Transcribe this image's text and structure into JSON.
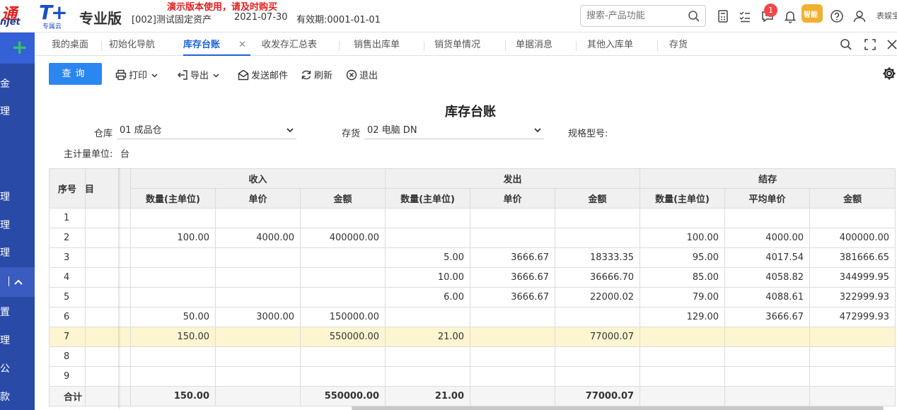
{
  "header": {
    "logo_cn": "通",
    "logo_en": "njet",
    "product_mark": "T+",
    "product_sub": "专属云",
    "edition": "专业版",
    "demo_notice": "演示版本使用，请及时购买",
    "account": "[002]测试固定资产",
    "date": "2021-07-30",
    "validity": "有效期:0001-01-01",
    "search_placeholder": "搜索-产品功能",
    "notification_count": "1",
    "mascot_text": "智能",
    "user_name": "表娱宝"
  },
  "sidebar": {
    "items": [
      "金",
      "理",
      "理",
      "理",
      "理",
      "置",
      "理",
      "公",
      "款"
    ]
  },
  "tabs": [
    {
      "label": "我的桌面"
    },
    {
      "label": "初始化导航"
    },
    {
      "label": "库存台账",
      "active": true
    },
    {
      "label": "收发存汇总表"
    },
    {
      "label": "销售出库单"
    },
    {
      "label": "销货单情况"
    },
    {
      "label": "单据消息"
    },
    {
      "label": "其他入库单"
    },
    {
      "label": "存货"
    }
  ],
  "tab_close": "✕",
  "toolbar": {
    "query": "查询",
    "print": "打印",
    "export": "导出",
    "send_mail": "发送邮件",
    "refresh": "刷新",
    "exit": "退出"
  },
  "report": {
    "title": "库存台账",
    "warehouse_label": "仓库",
    "warehouse_value": "01 成品仓",
    "inventory_label": "存货",
    "inventory_value": "02 电脑 DN",
    "spec_label": "规格型号:",
    "unit_label": "主计量单位:",
    "unit_value": "台"
  },
  "table": {
    "col_seq": "序号",
    "col_project": "项目",
    "groups": [
      "收入",
      "发出",
      "结存"
    ],
    "sub_headers": [
      "数量(主单位)",
      "单价",
      "金额",
      "数量(主单位)",
      "单价",
      "金额",
      "数量(主单位)",
      "平均单价",
      "金额"
    ],
    "rows": [
      [
        "1",
        "",
        "",
        "",
        "",
        "",
        "",
        "",
        "",
        "",
        ""
      ],
      [
        "2",
        "",
        "100.00",
        "4000.00",
        "400000.00",
        "",
        "",
        "",
        "100.00",
        "4000.00",
        "400000.00"
      ],
      [
        "3",
        "",
        "",
        "",
        "",
        "5.00",
        "3666.67",
        "18333.35",
        "95.00",
        "4017.54",
        "381666.65"
      ],
      [
        "4",
        "",
        "",
        "",
        "",
        "10.00",
        "3666.67",
        "36666.70",
        "85.00",
        "4058.82",
        "344999.95"
      ],
      [
        "5",
        "",
        "",
        "",
        "",
        "6.00",
        "3666.67",
        "22000.02",
        "79.00",
        "4088.61",
        "322999.93"
      ],
      [
        "6",
        "",
        "50.00",
        "3000.00",
        "150000.00",
        "",
        "",
        "",
        "129.00",
        "3666.67",
        "472999.93"
      ],
      [
        "7",
        "",
        "150.00",
        "",
        "550000.00",
        "21.00",
        "",
        "77000.07",
        "",
        "",
        ""
      ],
      [
        "8",
        "",
        "",
        "",
        "",
        "",
        "",
        "",
        "",
        "",
        ""
      ],
      [
        "9",
        "",
        "",
        "",
        "",
        "",
        "",
        "",
        "",
        "",
        ""
      ]
    ],
    "total": [
      "合计",
      "",
      "150.00",
      "",
      "550000.00",
      "21.00",
      "",
      "77000.07",
      "",
      "",
      ""
    ],
    "highlight_row": 6
  }
}
